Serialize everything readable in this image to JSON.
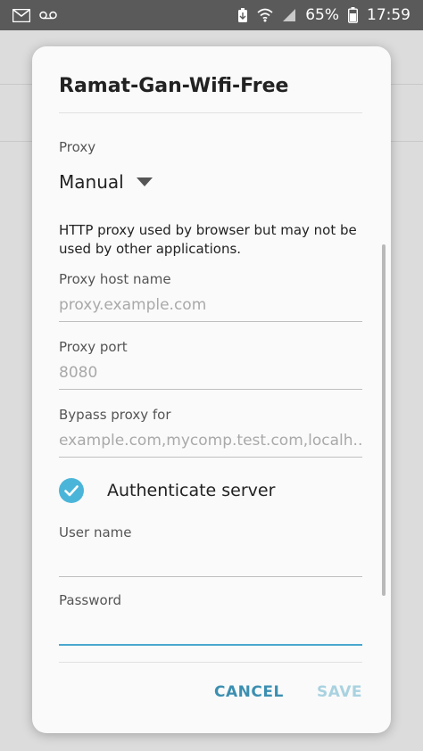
{
  "status_bar": {
    "battery_percent": "65%",
    "time": "17:59",
    "icons": [
      "gmail-icon",
      "voicemail-icon",
      "battery-saver-icon",
      "wifi-icon",
      "signal-icon",
      "battery-icon"
    ]
  },
  "dialog": {
    "title": "Ramat-Gan-Wifi-Free",
    "proxy": {
      "label": "Proxy",
      "selected": "Manual"
    },
    "note": "HTTP proxy used by browser but may not be used by other applications.",
    "host": {
      "label": "Proxy host name",
      "placeholder": "proxy.example.com",
      "value": ""
    },
    "port": {
      "label": "Proxy port",
      "placeholder": "8080",
      "value": ""
    },
    "bypass": {
      "label": "Bypass proxy for",
      "placeholder": "example.com,mycomp.test.com,localh...",
      "value": ""
    },
    "authenticate": {
      "label": "Authenticate server",
      "checked": true
    },
    "username": {
      "label": "User name",
      "value": ""
    },
    "password": {
      "label": "Password",
      "value": ""
    },
    "buttons": {
      "cancel": "CANCEL",
      "save": "SAVE"
    }
  },
  "colors": {
    "accent": "#4aa8cf",
    "checkbox": "#4bb5d9",
    "cancel_text": "#3c8fb1",
    "save_disabled_text": "#a9d2e0"
  }
}
